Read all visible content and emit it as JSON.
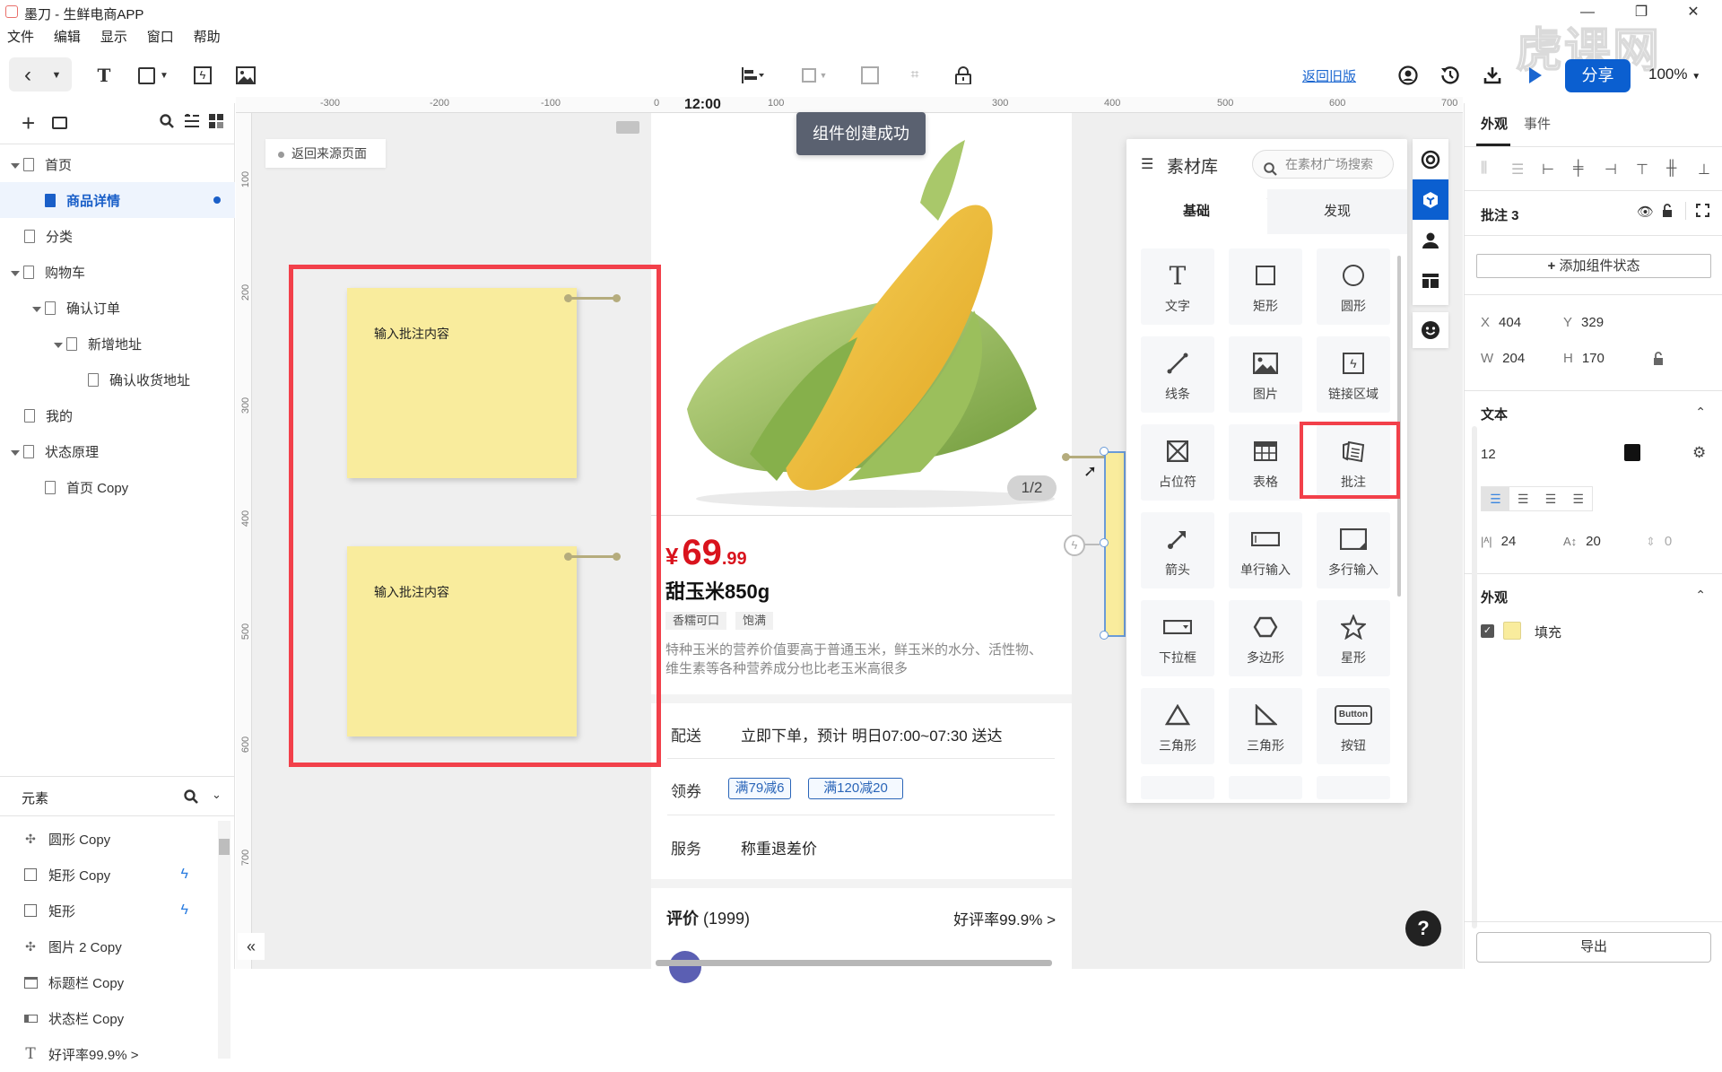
{
  "window": {
    "app_title": "墨刀 - 生鲜电商APP",
    "minimize": "—",
    "maximize": "❐",
    "close": "✕",
    "watermark": "虎课网"
  },
  "menu": [
    "文件",
    "编辑",
    "显示",
    "窗口",
    "帮助"
  ],
  "toolbar": {
    "back_old_version": "返回旧版",
    "share": "分享",
    "zoom": "100%",
    "icons": [
      "back-icon",
      "dropdown-icon",
      "text-tool-icon",
      "rectangle-tool-icon",
      "link-area-icon",
      "image-tool-icon",
      "align-icon",
      "group-icon",
      "fit-icon",
      "crop-icon",
      "lock-icon",
      "user-icon",
      "history-icon",
      "download-icon",
      "play-icon"
    ]
  },
  "pages_panel": {
    "items": [
      {
        "label": "首页",
        "level": 0,
        "expanded": true
      },
      {
        "label": "商品详情",
        "level": 1,
        "active": true
      },
      {
        "label": "分类",
        "level": 0
      },
      {
        "label": "购物车",
        "level": 0,
        "expanded": true
      },
      {
        "label": "确认订单",
        "level": 1,
        "expanded": true
      },
      {
        "label": "新增地址",
        "level": 2,
        "expanded": true
      },
      {
        "label": "确认收货地址",
        "level": 3
      },
      {
        "label": "我的",
        "level": 0
      },
      {
        "label": "状态原理",
        "level": 0,
        "expanded": true
      },
      {
        "label": "首页 Copy",
        "level": 1
      }
    ]
  },
  "elements_panel": {
    "title": "元素",
    "items": [
      {
        "label": "圆形 Copy",
        "icon": "pinwheel-icon",
        "has_interaction": false
      },
      {
        "label": "矩形 Copy",
        "icon": "rectangle-icon",
        "has_interaction": true
      },
      {
        "label": "矩形",
        "icon": "rectangle-icon",
        "has_interaction": true
      },
      {
        "label": "图片 2 Copy",
        "icon": "pinwheel-icon",
        "has_interaction": false
      },
      {
        "label": "标题栏 Copy",
        "icon": "titlebar-icon",
        "has_interaction": false
      },
      {
        "label": "状态栏 Copy",
        "icon": "statusbar-icon",
        "has_interaction": false
      },
      {
        "label": "好评率99.9% >",
        "icon": "text-icon",
        "has_interaction": false
      }
    ]
  },
  "canvas": {
    "back_source": "返回来源页面",
    "toast": "组件创建成功",
    "ruler_top": [
      "-300",
      "-200",
      "-100",
      "0",
      "100",
      "300",
      "400",
      "500",
      "600",
      "700"
    ],
    "ruler_left": [
      "100",
      "200",
      "300",
      "400",
      "500",
      "600",
      "700"
    ],
    "status_time": "12:00",
    "notes": [
      {
        "text": "输入批注内容"
      },
      {
        "text": "输入批注内容"
      }
    ]
  },
  "product": {
    "pager": "1/2",
    "currency": "¥",
    "price_int": "69",
    "price_dec": ".99",
    "name": "甜玉米850g",
    "tags": [
      "香糯可口",
      "饱满"
    ],
    "description": "特种玉米的营养价值要高于普通玉米，鲜玉米的水分、活性物、维生素等各种营养成分也比老玉米高很多",
    "delivery_label": "配送",
    "delivery_value": "立即下单，预计 明日07:00~07:30 送达",
    "coupon_label": "领券",
    "coupons": [
      "满79减6",
      "满120减20"
    ],
    "service_label": "服务",
    "service_value": "称重退差价",
    "review_label": "评价",
    "review_count": "(1999)",
    "review_rate": "好评率99.9% >"
  },
  "library": {
    "title": "素材库",
    "search_placeholder": "在素材广场搜索",
    "tabs": [
      "基础",
      "发现"
    ],
    "active_tab": "基础",
    "tiles": [
      {
        "label": "文字",
        "icon": "text-icon"
      },
      {
        "label": "矩形",
        "icon": "rectangle-icon"
      },
      {
        "label": "圆形",
        "icon": "circle-icon"
      },
      {
        "label": "线条",
        "icon": "line-icon"
      },
      {
        "label": "图片",
        "icon": "image-icon"
      },
      {
        "label": "链接区域",
        "icon": "link-area-icon"
      },
      {
        "label": "占位符",
        "icon": "placeholder-icon"
      },
      {
        "label": "表格",
        "icon": "table-icon"
      },
      {
        "label": "批注",
        "icon": "annotation-icon",
        "highlighted": true
      },
      {
        "label": "箭头",
        "icon": "arrow-icon"
      },
      {
        "label": "单行输入",
        "icon": "single-input-icon"
      },
      {
        "label": "多行输入",
        "icon": "multi-input-icon"
      },
      {
        "label": "下拉框",
        "icon": "dropdown-icon"
      },
      {
        "label": "多边形",
        "icon": "polygon-icon"
      },
      {
        "label": "星形",
        "icon": "star-icon"
      },
      {
        "label": "三角形",
        "icon": "triangle-icon"
      },
      {
        "label": "三角形",
        "icon": "right-triangle-icon"
      },
      {
        "label": "按钮",
        "icon": "button-icon"
      }
    ],
    "button_glyph": "Button"
  },
  "side_strip": [
    "target-icon",
    "component-icon",
    "user-icon",
    "layout-icon",
    "emoji-icon"
  ],
  "properties": {
    "tabs": [
      "外观",
      "事件"
    ],
    "active_tab": "外观",
    "component_name": "批注 3",
    "add_state": "添加组件状态",
    "x_label": "X",
    "x": "404",
    "y_label": "Y",
    "y": "329",
    "w_label": "W",
    "w": "204",
    "h_label": "H",
    "h": "170",
    "text_section": "文本",
    "font_size": "12",
    "text_color": "#111111",
    "letter_spacing": "24",
    "line_height": "20",
    "paragraph_spacing": "0",
    "appearance_section": "外观",
    "fill_label": "填充",
    "fill_checked": true,
    "fill_color": "#f9ec9d",
    "export": "导出"
  },
  "help": "?"
}
